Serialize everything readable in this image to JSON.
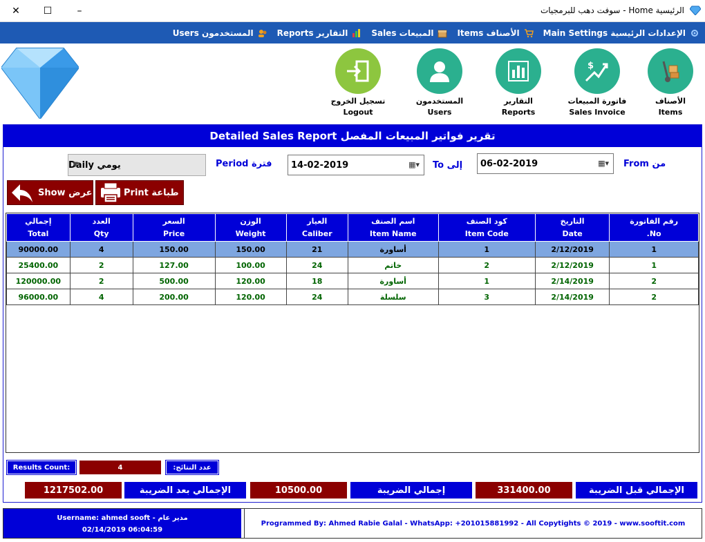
{
  "window": {
    "title": "الرئيسية Home - سوفت دهب للبرمجيات",
    "minimize": "–",
    "maximize": "☐",
    "close": "✕"
  },
  "menu": [
    {
      "label": "الإعدادات الرئيسية Main Settings",
      "icon": "settings-icon"
    },
    {
      "label": "الأصناف Items",
      "icon": "cart-icon"
    },
    {
      "label": "المبيعات Sales",
      "icon": "box-icon"
    },
    {
      "label": "التقارير Reports",
      "icon": "chart-icon"
    },
    {
      "label": "المستخدمون Users",
      "icon": "users-icon"
    }
  ],
  "toolbar": {
    "items": {
      "ar": "الأصناف",
      "en": "Items"
    },
    "sales": {
      "ar": "فاتورة المبيعات",
      "en": "Sales Invoice"
    },
    "reports": {
      "ar": "التقارير",
      "en": "Reports"
    },
    "users": {
      "ar": "المستخدمون",
      "en": "Users"
    },
    "logout": {
      "ar": "تسجيل الخروج",
      "en": "Logout"
    }
  },
  "report": {
    "header": "Detailed Sales Report تقرير فواتير المبيعات المفصل",
    "from_label": "من From",
    "from_date": "06-02-2019",
    "to_label": "إلى To",
    "to_date": "14-02-2019",
    "period_label": "فترة Period",
    "period_value": "يومي Daily",
    "print_label": "طباعة Print",
    "show_label": "عرض Show"
  },
  "table": {
    "headers": [
      {
        "ar": "رقم الفاتورة",
        "en": "No."
      },
      {
        "ar": "التاريخ",
        "en": "Date"
      },
      {
        "ar": "كود الصنف",
        "en": "Item Code"
      },
      {
        "ar": "اسم الصنف",
        "en": "Item Name"
      },
      {
        "ar": "العيار",
        "en": "Caliber"
      },
      {
        "ar": "الوزن",
        "en": "Weight"
      },
      {
        "ar": "السعر",
        "en": "Price"
      },
      {
        "ar": "العدد",
        "en": "Qty"
      },
      {
        "ar": "إجمالي",
        "en": "Total"
      }
    ],
    "rows": [
      [
        "1",
        "2/12/2019",
        "1",
        "أساورة",
        "21",
        "150.00",
        "150.00",
        "4",
        "90000.00"
      ],
      [
        "1",
        "2/12/2019",
        "2",
        "خاتم",
        "24",
        "100.00",
        "127.00",
        "2",
        "25400.00"
      ],
      [
        "2",
        "2/14/2019",
        "1",
        "أساورة",
        "18",
        "120.00",
        "500.00",
        "2",
        "120000.00"
      ],
      [
        "2",
        "2/14/2019",
        "3",
        "سلسلة",
        "24",
        "120.00",
        "200.00",
        "4",
        "96000.00"
      ]
    ]
  },
  "summary": {
    "results_count_label_en": "Results Count:",
    "results_count_value": "4",
    "results_count_label_ar": "عدد النتائج:",
    "before_tax_label": "الإجمالي قبل الضريبة",
    "before_tax_value": "331400.00",
    "tax_label": "إجمالي الضريبة",
    "tax_value": "10500.00",
    "after_tax_label": "الإجمالي بعد الضريبة",
    "after_tax_value": "1217502.00"
  },
  "status": {
    "user_line": "Username: ahmed sooft - مدير عام",
    "datetime": "02/14/2019 06:04:59",
    "copyright": "Programmed By: Ahmed Rabie Galal - WhatsApp: +201015881992 - All Copytights © 2019 - www.sooftit.com"
  },
  "colors": {
    "menu_blue": "#1e5ab4",
    "panel_blue": "#0000d8",
    "dark_red": "#8b0000",
    "selected_row": "#7ea6e0",
    "row_text_green": "#006400"
  }
}
